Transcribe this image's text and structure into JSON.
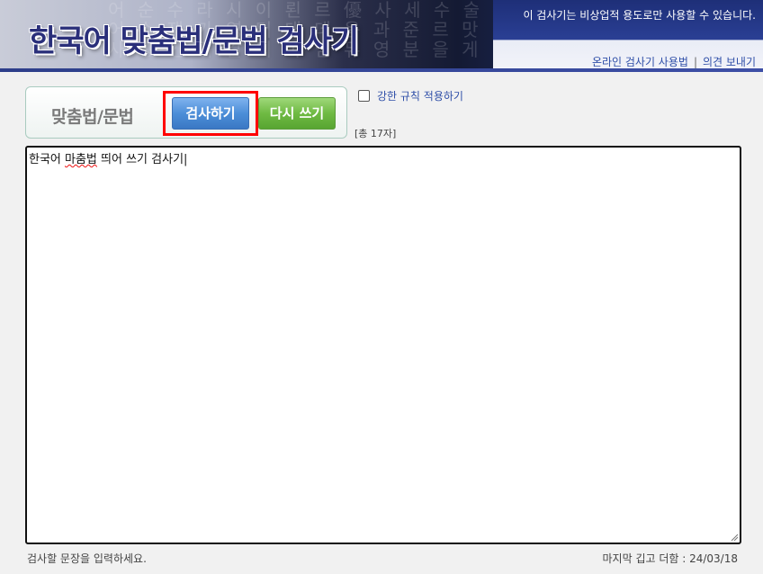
{
  "header": {
    "title": "한국어 맞춤법/문법 검사기",
    "notice": "이 검사기는 비상업적 용도로만 사용할 수 있습니다.",
    "links": {
      "usage": "온라인 검사기 사용법",
      "separator": "|",
      "feedback": "의견 보내기"
    },
    "background_chars": [
      "어 순 수 라 시 이 뢴 르 優 사 세 수 술",
      "어 수 쟁 가 영 더 대 데 음 과 준 르 맛",
      "사 장 인 의 갈 의 아 님 뮤 영 분 을 게"
    ]
  },
  "controls": {
    "mode_label": "맞춤법/문법",
    "check_button": "검사하기",
    "reset_button": "다시 쓰기",
    "strict_label": "강한 규칙 적용하기",
    "strict_checked": false,
    "count_text": "[총 17자]"
  },
  "editor": {
    "parts": {
      "p1": "한국어 ",
      "misspelled": "마춤법",
      "p2": " 띄어 쓰기 검사기|"
    }
  },
  "footer": {
    "hint": "검사할 문장을 입력하세요.",
    "updated": "마지막 깁고 더함 : 24/03/18"
  },
  "colors": {
    "highlight": "#ff0000",
    "check_button": "#4c8ed8",
    "reset_button": "#6fba43",
    "title": "#2a2f7a",
    "link": "#2f4fa8"
  }
}
